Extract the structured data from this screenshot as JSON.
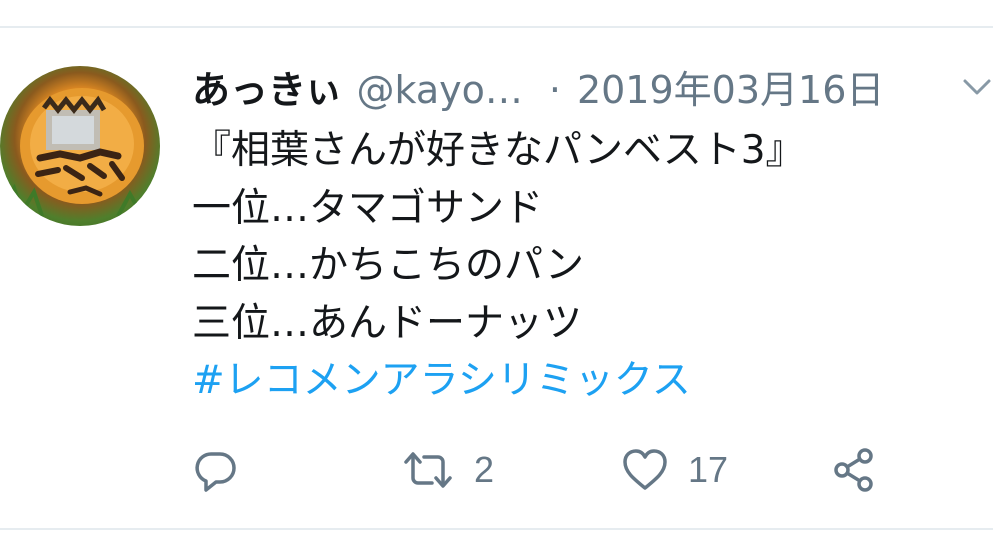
{
  "tweet": {
    "author_name": "あっきぃ",
    "author_handle": "@kayo…",
    "separator": "·",
    "date": "2019年03月16日",
    "lines": [
      "『相葉さんが好きなパンベスト3』",
      "一位…タマゴサンド",
      "二位…かちこちのパン",
      "三位…あんドーナッツ"
    ],
    "hashtag": "#レコメンアラシリミックス"
  },
  "actions": {
    "reply_icon": "reply-icon",
    "retweet_icon": "retweet-icon",
    "retweet_count": "2",
    "like_icon": "heart-icon",
    "like_count": "17",
    "share_icon": "share-icon"
  },
  "colors": {
    "text": "#14171a",
    "secondary": "#657786",
    "link": "#1da1f2",
    "divider": "#e6ecf0"
  }
}
